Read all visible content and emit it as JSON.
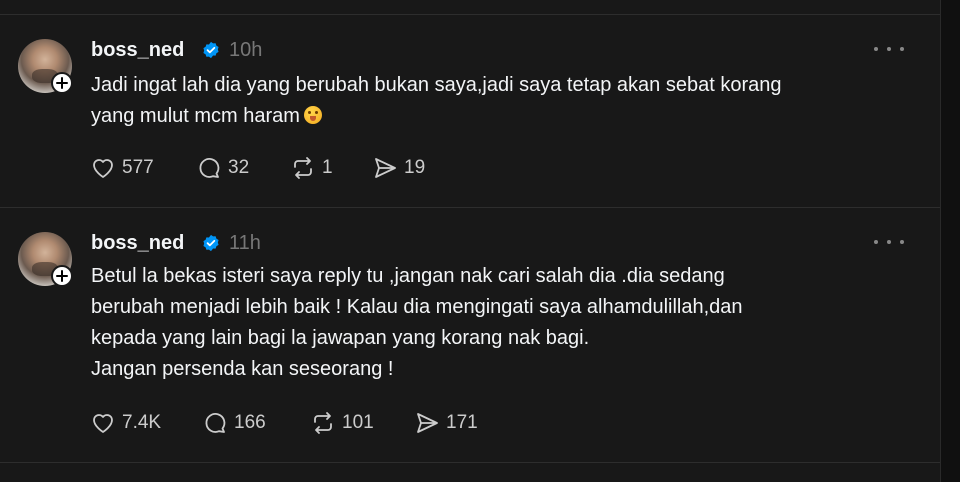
{
  "posts": [
    {
      "username": "boss_ned",
      "time": "10h",
      "text_lines": [
        "Jadi ingat lah dia yang berubah bukan saya,jadi saya tetap akan sebat korang",
        "yang mulut mcm haram"
      ],
      "emoji": "face-with-hand-over-mouth",
      "likes": "577",
      "replies": "32",
      "reposts": "1",
      "shares": "19"
    },
    {
      "username": "boss_ned",
      "time": "11h",
      "text_lines": [
        "Betul la bekas isteri saya reply tu ,jangan nak cari salah dia .dia sedang",
        "berubah menjadi lebih baik ! Kalau dia mengingati saya alhamdulillah,dan",
        "kepada yang lain bagi la jawapan yang korang nak bagi.",
        "Jangan persenda kan seseorang !"
      ],
      "likes": "7.4K",
      "replies": "166",
      "reposts": "101",
      "shares": "171"
    }
  ],
  "colors": {
    "background": "#181818",
    "text": "#f3f5f7",
    "muted": "#777777",
    "verified": "#0095f6"
  }
}
